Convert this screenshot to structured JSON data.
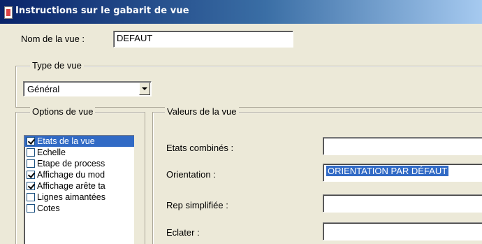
{
  "window": {
    "title": "Instructions sur le gabarit de vue"
  },
  "view_name": {
    "label": "Nom de la vue :",
    "value": "DEFAUT"
  },
  "view_type": {
    "group_label": "Type de vue",
    "selected": "Général"
  },
  "view_options": {
    "group_label": "Options de vue",
    "items": [
      {
        "label": "Etats de la vue",
        "checked": true,
        "selected": true
      },
      {
        "label": "Echelle",
        "checked": false,
        "selected": false
      },
      {
        "label": "Etape de process",
        "checked": false,
        "selected": false
      },
      {
        "label": "Affichage du mod",
        "checked": true,
        "selected": false
      },
      {
        "label": "Affichage arête ta",
        "checked": true,
        "selected": false
      },
      {
        "label": "Lignes aimantées",
        "checked": false,
        "selected": false
      },
      {
        "label": "Cotes",
        "checked": false,
        "selected": false
      }
    ]
  },
  "view_values": {
    "group_label": "Valeurs de la vue",
    "fields": [
      {
        "label": "Etats combinés :",
        "value": ""
      },
      {
        "label": "Orientation :",
        "value": "ORIENTATION PAR DÉFAUT"
      },
      {
        "label": "Rep simplifiée :",
        "value": ""
      },
      {
        "label": "Eclater :",
        "value": ""
      }
    ]
  },
  "colors": {
    "title_bar_start": "#0a246a",
    "title_bar_end": "#a6caf0",
    "selection": "#316ac5",
    "dialog_bg": "#ece9d8"
  }
}
